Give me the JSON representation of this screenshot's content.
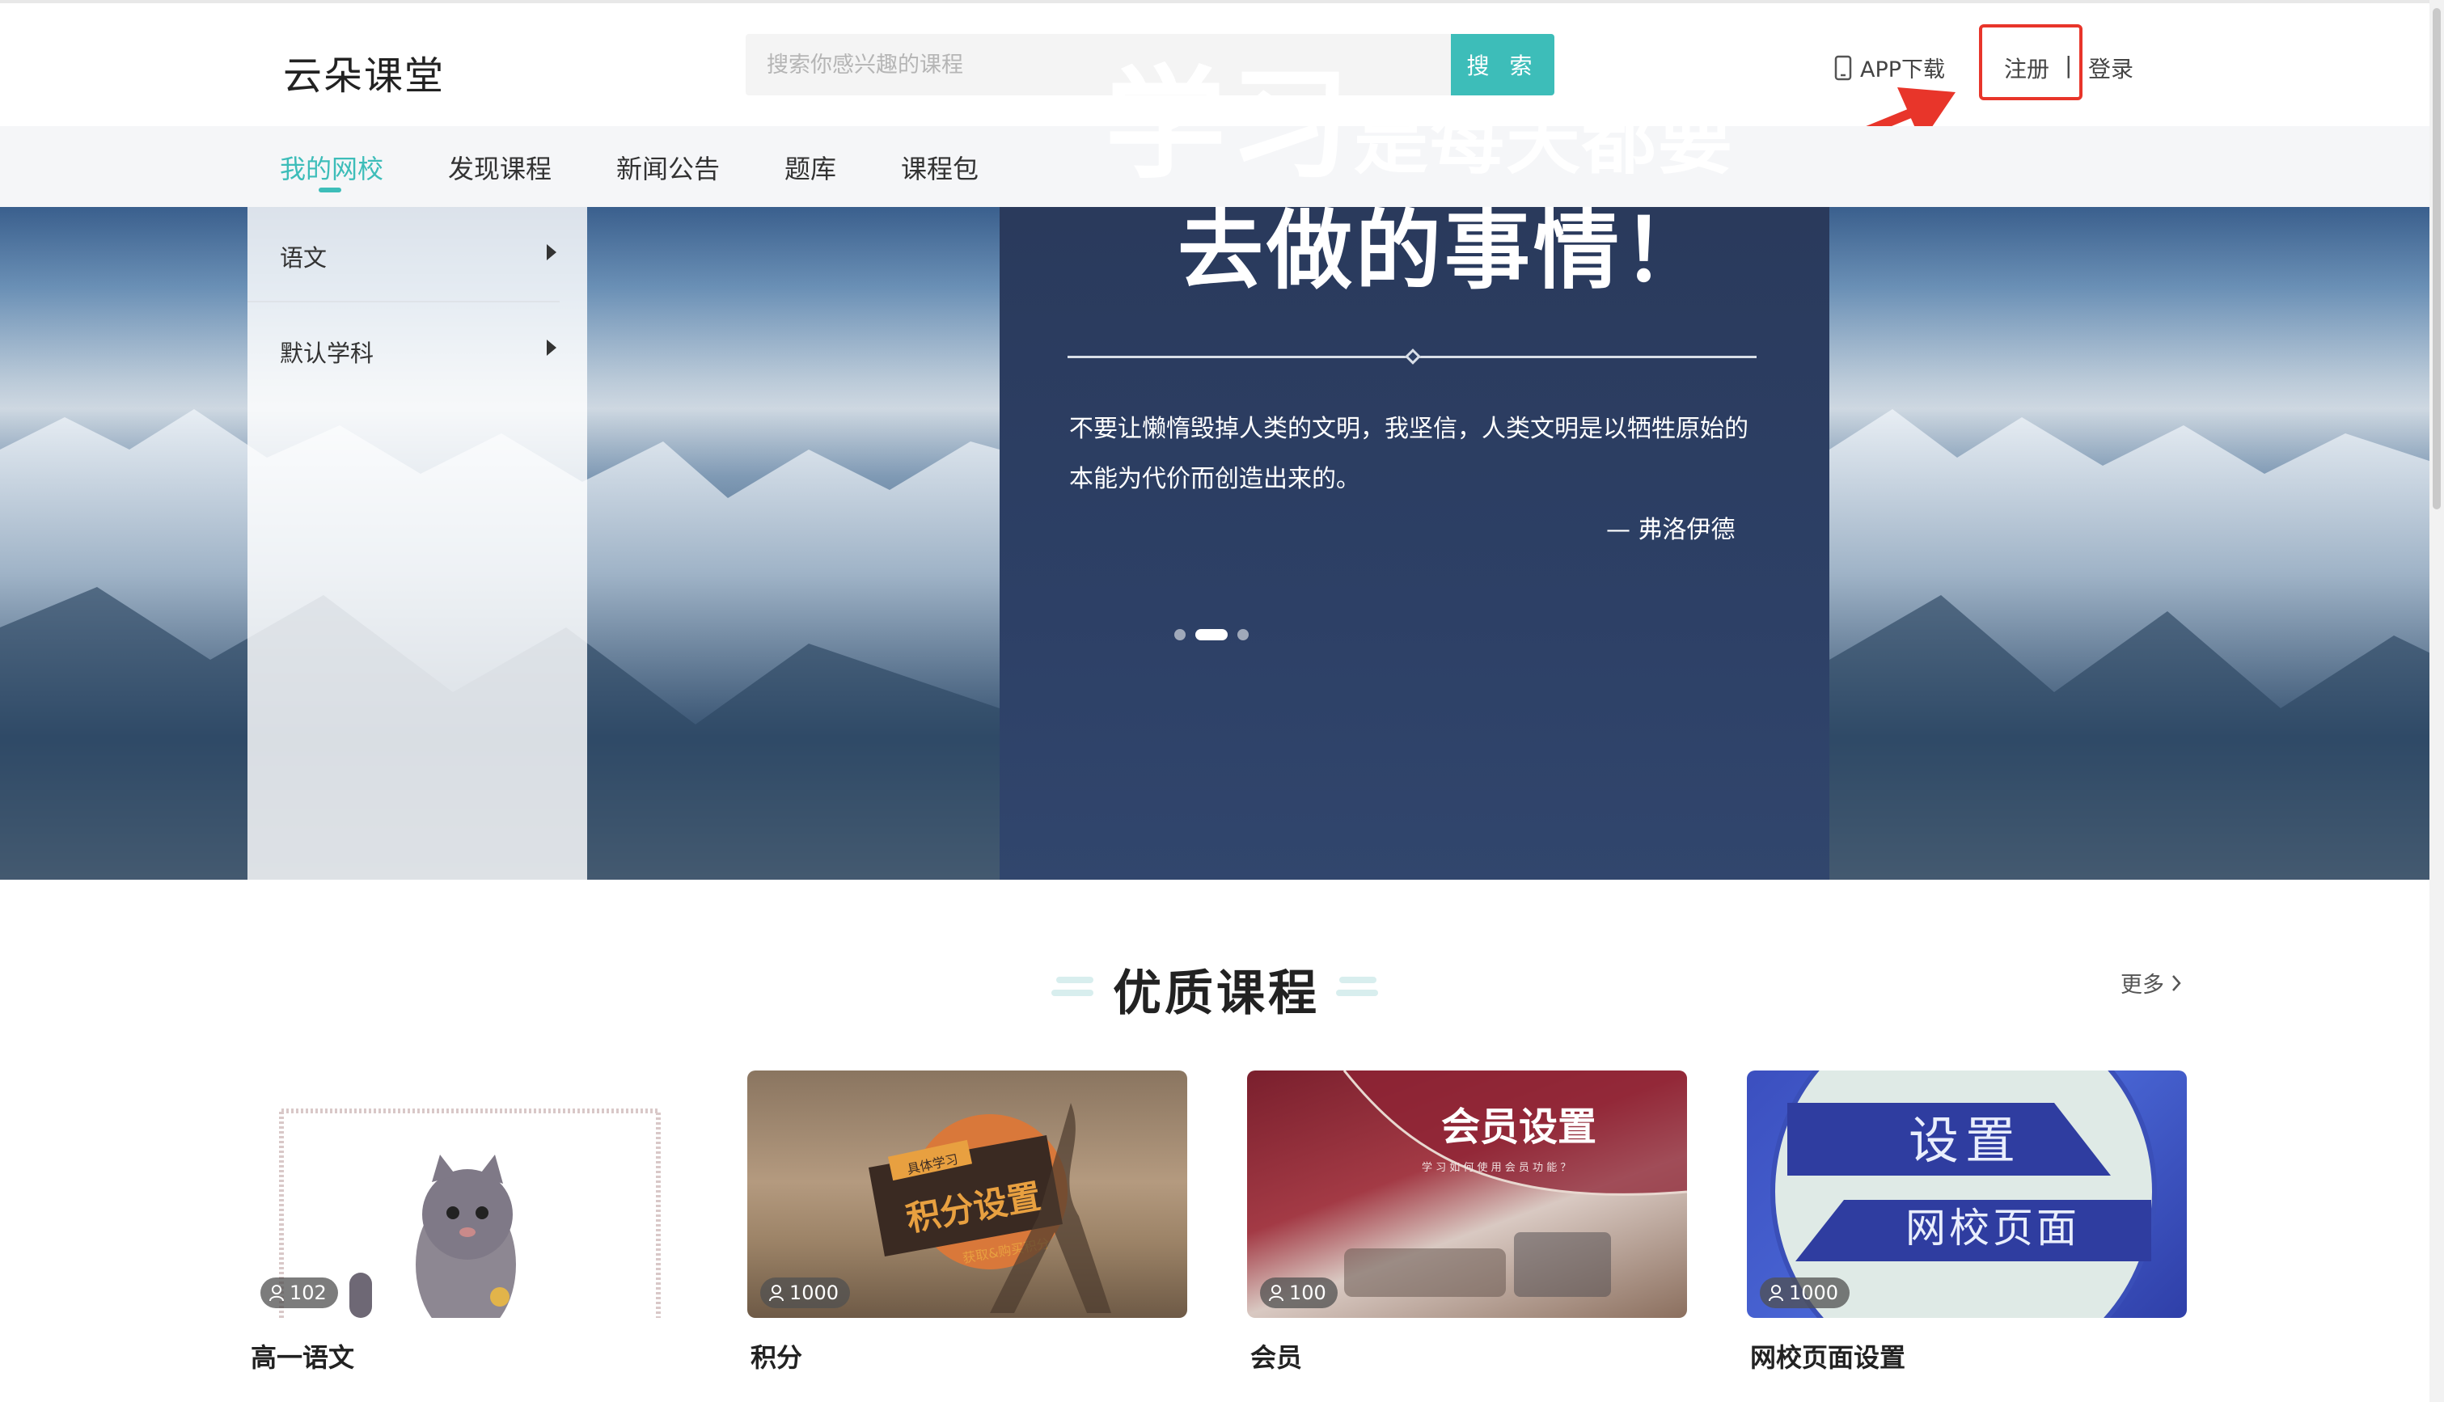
{
  "header": {
    "logo": "云朵课堂",
    "search_placeholder": "搜索你感兴趣的课程",
    "search_button": "搜 索",
    "app_download": "APP下载",
    "register": "注册",
    "separator": "|",
    "login": "登录"
  },
  "nav": {
    "items": [
      {
        "label": "我的网校",
        "active": true
      },
      {
        "label": "发现课程",
        "active": false
      },
      {
        "label": "新闻公告",
        "active": false
      },
      {
        "label": "题库",
        "active": false
      },
      {
        "label": "课程包",
        "active": false
      }
    ]
  },
  "subjects": [
    {
      "label": "语文"
    },
    {
      "label": "默认学科"
    }
  ],
  "banner": {
    "headline_big": "学习",
    "headline_rest": "是每天都要",
    "headline_line2": "去做的事情！",
    "quote": "不要让懒惰毁掉人类的文明，我坚信，人类文明是以牺牲原始的本能为代价而创造出来的。",
    "author": "— 弗洛伊德",
    "slides": 3,
    "active_slide": 2
  },
  "section": {
    "title": "优质课程",
    "more": "更多"
  },
  "courses": [
    {
      "title": "高一语文",
      "students": "102"
    },
    {
      "title": "积分",
      "students": "1000",
      "image_text": "积分设置",
      "image_sub1": "具体学习",
      "image_sub2": "获取&购买积分"
    },
    {
      "title": "会员",
      "students": "100",
      "image_text": "会员设置",
      "image_sub": "学 习 如 何 使 用 会 员 功 能 ？"
    },
    {
      "title": "网校页面设置",
      "students": "1000",
      "image_text": "设置",
      "image_text2": "网校页面"
    }
  ],
  "colors": {
    "accent": "#3dbdb9",
    "annotation": "#e8352a"
  }
}
